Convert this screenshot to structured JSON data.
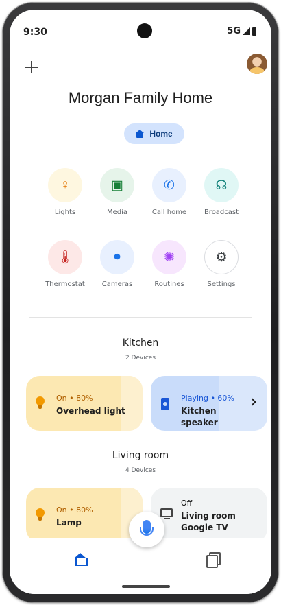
{
  "status_bar": {
    "time": "9:30",
    "network": "5G"
  },
  "header": {
    "title": "Morgan Family Home",
    "home_chip": "Home"
  },
  "quick_actions": [
    {
      "label": "Lights",
      "icon": "lightbulb-icon",
      "glyph": "♀",
      "bg": "#fef7e0",
      "fg": "#e37400"
    },
    {
      "label": "Media",
      "icon": "media-icon",
      "glyph": "▣",
      "bg": "#e6f4ea",
      "fg": "#188038"
    },
    {
      "label": "Call home",
      "icon": "phone-icon",
      "glyph": "✆",
      "bg": "#e8f0fe",
      "fg": "#1a73e8"
    },
    {
      "label": "Broadcast",
      "icon": "broadcast-icon",
      "glyph": "☊",
      "bg": "#e0f7f5",
      "fg": "#12827a"
    },
    {
      "label": "Thermostat",
      "icon": "thermostat-icon",
      "glyph": "🌡",
      "bg": "#fde8e7",
      "fg": "#c5221f"
    },
    {
      "label": "Cameras",
      "icon": "camera-icon",
      "glyph": "⏺",
      "bg": "#e8f0fe",
      "fg": "#1a73e8"
    },
    {
      "label": "Routines",
      "icon": "routines-icon",
      "glyph": "✺",
      "bg": "#f7e6fd",
      "fg": "#a142f4"
    },
    {
      "label": "Settings",
      "icon": "gear-icon",
      "glyph": "⚙",
      "bg": "#ffffff",
      "fg": "#3c4043"
    }
  ],
  "rooms": [
    {
      "name": "Kitchen",
      "count": "2 Devices",
      "devices": [
        {
          "status": "On • 80%",
          "name": "Overhead light",
          "type": "light",
          "status_color": "#b06000"
        },
        {
          "status": "Playing • 60%",
          "name": "Kitchen speaker",
          "type": "speaker",
          "status_color": "#1a57d6"
        }
      ]
    },
    {
      "name": "Living room",
      "count": "4 Devices",
      "devices": [
        {
          "status": "On • 80%",
          "name": "Lamp",
          "type": "light",
          "status_color": "#b06000"
        },
        {
          "status": "Off",
          "name": "Living room Google TV",
          "type": "tv",
          "status_color": "#5f6368"
        }
      ]
    }
  ],
  "colors": {
    "accent": "#0b57d0",
    "light_card": "#fce8b2",
    "speaker_card": "#c9dcfa",
    "off_card": "#f1f3f4"
  }
}
